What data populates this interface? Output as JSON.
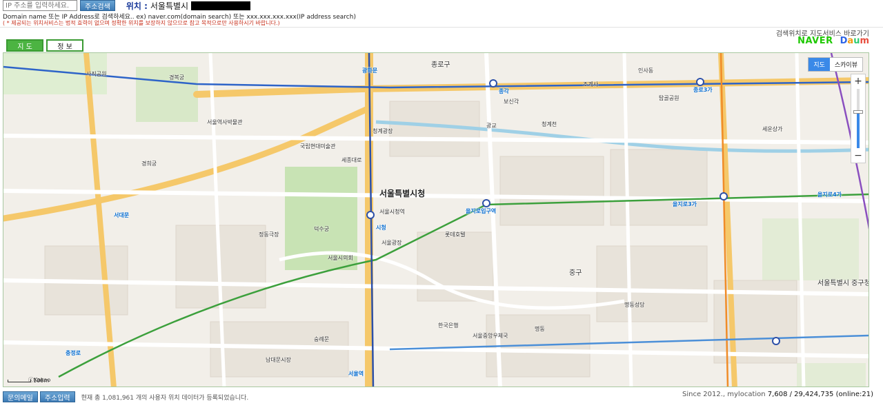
{
  "search": {
    "ip_placeholder": "IP 주소를 입력하세요.",
    "search_button": "주소검색",
    "location_label": "위치 :",
    "location_value": "서울특별시"
  },
  "hints": {
    "line1": "Domain name 또는 IP Address로 검색하세요.. ex) naver.com(domain search) 또는 xxx.xxx.xxx.xxx(IP address search)",
    "line2": "( * 제공되는 위치서비스는 법적 효력이 없으며 정확한 위치를 보장하지 않으므로 참고 목적으로만 사용하시기 바랍니다.)"
  },
  "shortcut": {
    "label": "검색위치로 지도서비스 바로가기",
    "naver": "NAVER",
    "daum": [
      "D",
      "a",
      "u",
      "m"
    ]
  },
  "tabs": [
    {
      "label": "지 도",
      "active": true
    },
    {
      "label": "정 보",
      "active": false
    }
  ],
  "map": {
    "type_buttons": [
      {
        "label": "지도",
        "active": true
      },
      {
        "label": "스카이뷰",
        "active": false
      }
    ],
    "zoom_in": "+",
    "zoom_out": "−",
    "zoom_level": 0.62,
    "scale_label": "100m",
    "copyright": "ⓒKakao",
    "center_label": "서울특별시청",
    "labels": [
      "서울특별시청",
      "시청",
      "광화문",
      "종각",
      "을지로입구역",
      "을지로3가",
      "종로3가",
      "서대문",
      "충정로",
      "서울역",
      "경복궁",
      "덕수궁",
      "청계천",
      "서울광장",
      "세종대로",
      "서울특별시 중구청",
      "사직공원",
      "서울시의회",
      "명동",
      "을지로4가",
      "종로구",
      "중구",
      "서울시청역",
      "청계광장",
      "서울역사박물관",
      "국립현대미술관",
      "경희궁",
      "정동극장",
      "한국은행",
      "롯데호텔",
      "세운상가",
      "인사동",
      "탑골공원",
      "조계사",
      "광교",
      "보신각",
      "서울중앙우체국",
      "명동성당",
      "남대문시장",
      "숭례문"
    ]
  },
  "bottom": {
    "contact_button": "문의메일",
    "input_button": "주소입력",
    "note": "현재 총 1,081,961 개의 사용자 위치 데이터가 등록되었습니다.",
    "since": "Since 2012., mylocation",
    "stats": "7,608 / 29,424,735 (online:21)"
  }
}
